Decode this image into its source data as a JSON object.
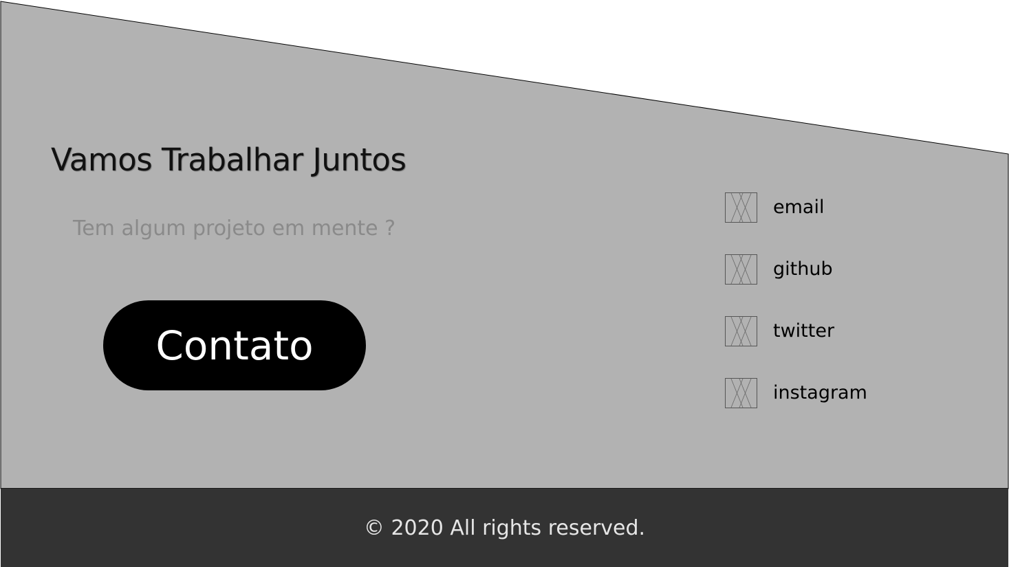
{
  "hero": {
    "title": "Vamos Trabalhar Juntos",
    "subtitle": "Tem algum projeto em mente ?",
    "cta_label": "Contato"
  },
  "social": {
    "items": [
      {
        "label": "email",
        "icon": "image-placeholder-icon"
      },
      {
        "label": "github",
        "icon": "image-placeholder-icon"
      },
      {
        "label": "twitter",
        "icon": "image-placeholder-icon"
      },
      {
        "label": "instagram",
        "icon": "image-placeholder-icon"
      }
    ]
  },
  "footer": {
    "text": "© 2020 All rights reserved."
  },
  "colors": {
    "section_bg": "#b2b2b2",
    "footer_bg": "#333333",
    "button_bg": "#000000",
    "button_text": "#ffffff",
    "subtitle_text": "#8a8a8a"
  }
}
